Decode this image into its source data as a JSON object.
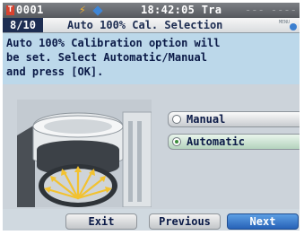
{
  "status": {
    "measurement_number": "0001",
    "time": "18:42:05",
    "mode": "Tra",
    "dashes": "--- ----",
    "icons": [
      "target-t-icon",
      "lightning-icon",
      "diamond-icon"
    ]
  },
  "titlebar": {
    "step": "8/10",
    "title": "Auto 100% Cal. Selection",
    "menu_icon_text": "MENU"
  },
  "instructions": {
    "line1": "Auto 100% Calibration option will",
    "line2": "be set. Select Automatic/Manual",
    "line3": "and press [OK]."
  },
  "options": {
    "manual": {
      "label": "Manual",
      "selected": false
    },
    "automatic": {
      "label": "Automatic",
      "selected": true
    }
  },
  "buttons": {
    "exit": "Exit",
    "previous": "Previous",
    "next": "Next"
  },
  "colors": {
    "status_bar": "#55585d",
    "step_badge": "#1d2d52",
    "screen_bg": "#bcd8ea",
    "next_button": "#2762b7",
    "arrow": "#f2c230",
    "selected_radio": "#3b8c3a"
  }
}
